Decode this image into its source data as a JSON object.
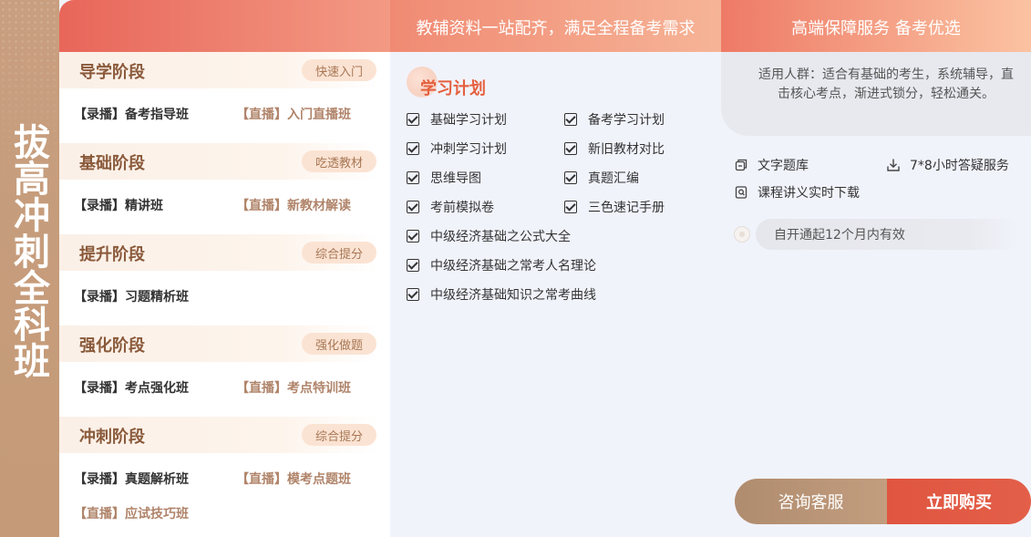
{
  "side_title": "拔高冲刺全科班",
  "header": {
    "mid": "教辅资料一站配齐，满足全程备考需求",
    "right": "高端保障服务 备考优选"
  },
  "stages": [
    {
      "title": "导学阶段",
      "tag": "快速入门",
      "rows": [
        {
          "rec": "【录播】备考指导班",
          "live": "【直播】入门直播班"
        }
      ]
    },
    {
      "title": "基础阶段",
      "tag": "吃透教材",
      "rows": [
        {
          "rec": "【录播】精讲班",
          "live": "【直播】新教材解读"
        }
      ]
    },
    {
      "title": "提升阶段",
      "tag": "综合提分",
      "rows": [
        {
          "rec": "【录播】习题精析班",
          "live": ""
        }
      ]
    },
    {
      "title": "强化阶段",
      "tag": "强化做题",
      "rows": [
        {
          "rec": "【录播】考点强化班",
          "live": "【直播】考点特训班"
        }
      ]
    },
    {
      "title": "冲刺阶段",
      "tag": "综合提分",
      "rows": [
        {
          "rec": "【录播】真题解析班",
          "live": "【直播】模考点题班"
        },
        {
          "rec": "【直播】应试技巧班",
          "live": ""
        }
      ]
    }
  ],
  "plan": {
    "title": "学习计划",
    "items": [
      "基础学习计划",
      "备考学习计划",
      "冲刺学习计划",
      "新旧教材对比",
      "思维导图",
      "真题汇编",
      "考前模拟卷",
      "三色速记手册",
      "中级经济基础之公式大全",
      "中级经济基础之常考人名理论",
      "中级经济基础知识之常考曲线"
    ]
  },
  "service": {
    "audience": "适用人群：适合有基础的考生，系统辅导，直击核心考点，渐进式锁分，轻松通关。",
    "items": [
      "文字题库",
      "7*8小时答疑服务",
      "课程讲义实时下载"
    ],
    "validity": "自开通起12个月内有效"
  },
  "actions": {
    "consult": "咨询客服",
    "buy": "立即购买"
  },
  "colors": {
    "accent": "#e5603f",
    "brown": "#8a5a3b",
    "strip": "#c49a78"
  },
  "icons": {
    "check": "checkbox-checked-icon",
    "bank": "question-bank-icon",
    "download": "download-icon",
    "notes": "notes-icon"
  }
}
